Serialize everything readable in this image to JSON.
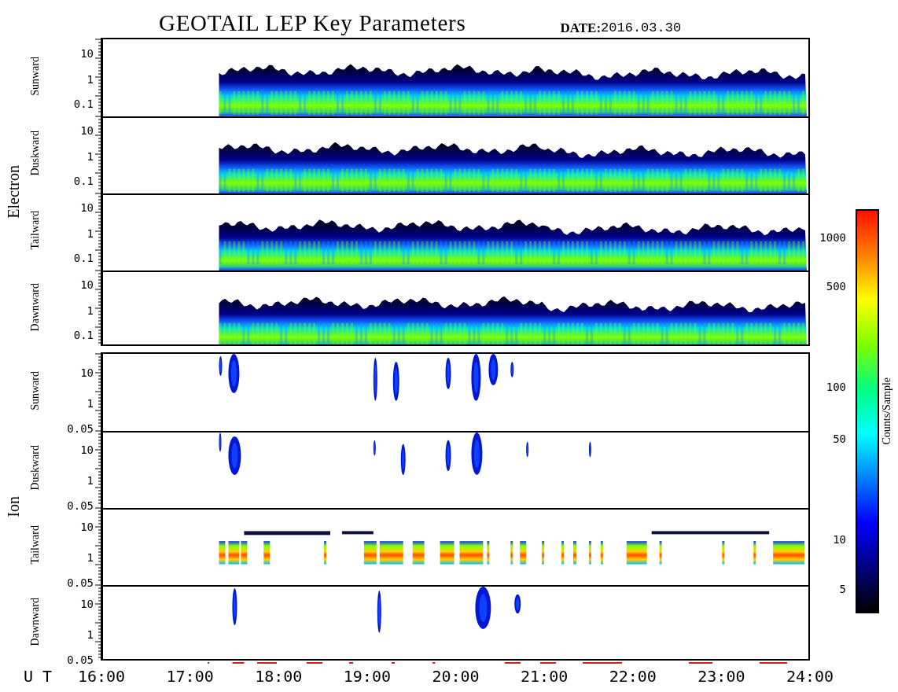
{
  "title": "GEOTAIL LEP Key Parameters",
  "date_label": "DATE:",
  "date": "2016.03.30",
  "groups": [
    {
      "species": "Electron",
      "kind": "electron",
      "panels": [
        {
          "direction": "Sunward",
          "y_ticks": [
            "10",
            "1",
            "0.1"
          ]
        },
        {
          "direction": "Duskward",
          "y_ticks": [
            "10",
            "1",
            "0.1"
          ]
        },
        {
          "direction": "Tailward",
          "y_ticks": [
            "10",
            "1",
            "0.1"
          ]
        },
        {
          "direction": "Dawnward",
          "y_ticks": [
            "10",
            "1",
            "0.1"
          ]
        }
      ]
    },
    {
      "species": "Ion",
      "kind": "ion",
      "panels": [
        {
          "direction": "Sunward",
          "y_ticks": [
            "10",
            "1",
            "0.05"
          ]
        },
        {
          "direction": "Duskward",
          "y_ticks": [
            "10",
            "1",
            "0.05"
          ]
        },
        {
          "direction": "Tailward",
          "y_ticks": [
            "10",
            "1",
            "0.05"
          ]
        },
        {
          "direction": "Dawnward",
          "y_ticks": [
            "10",
            "1",
            "0.05"
          ]
        }
      ]
    }
  ],
  "x_axis": {
    "label": "U T",
    "ticks": [
      "16:00",
      "17:00",
      "18:00",
      "19:00",
      "20:00",
      "21:00",
      "22:00",
      "23:00",
      "24:00"
    ]
  },
  "colorbar": {
    "label": "Counts/Sample",
    "ticks": [
      "1000",
      "500",
      "100",
      "50",
      "10",
      "5"
    ]
  }
}
